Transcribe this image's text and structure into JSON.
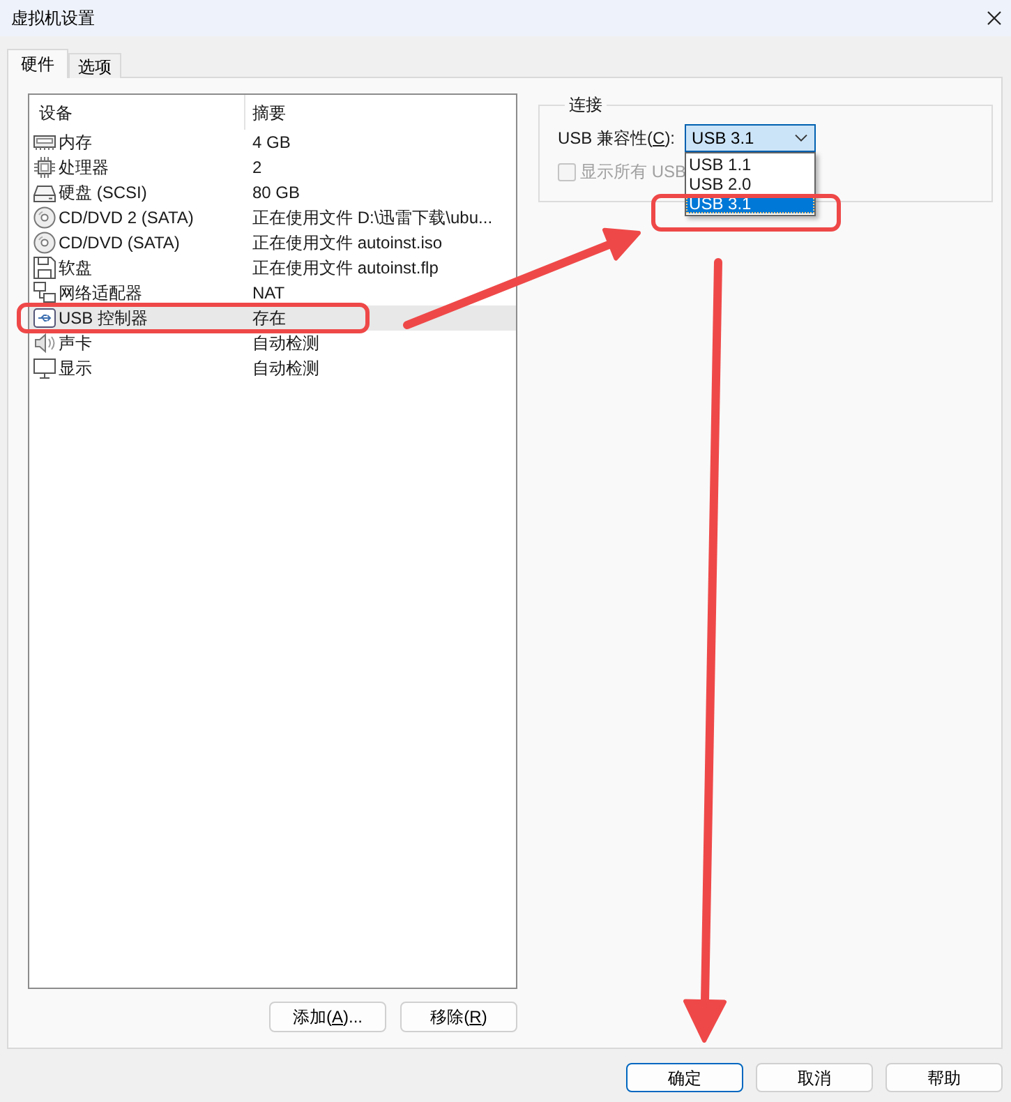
{
  "window": {
    "title": "虚拟机设置"
  },
  "tabs": [
    {
      "label": "硬件",
      "selected": true
    },
    {
      "label": "选项",
      "selected": false
    }
  ],
  "device_list": {
    "columns": [
      "设备",
      "摘要"
    ],
    "rows": [
      {
        "kind": "memory",
        "device": "内存",
        "summary": "4 GB",
        "selected": false,
        "annotated": false
      },
      {
        "kind": "processor",
        "device": "处理器",
        "summary": "2",
        "selected": false,
        "annotated": false
      },
      {
        "kind": "disk",
        "device": "硬盘 (SCSI)",
        "summary": "80 GB",
        "selected": false,
        "annotated": false
      },
      {
        "kind": "cdrom",
        "device": "CD/DVD 2 (SATA)",
        "summary": "正在使用文件 D:\\迅雷下载\\ubu...",
        "selected": false,
        "annotated": false
      },
      {
        "kind": "cdrom",
        "device": "CD/DVD (SATA)",
        "summary": "正在使用文件 autoinst.iso",
        "selected": false,
        "annotated": false
      },
      {
        "kind": "floppy",
        "device": "软盘",
        "summary": "正在使用文件 autoinst.flp",
        "selected": false,
        "annotated": false
      },
      {
        "kind": "network",
        "device": "网络适配器",
        "summary": "NAT",
        "selected": false,
        "annotated": false
      },
      {
        "kind": "usb",
        "device": "USB 控制器",
        "summary": "存在",
        "selected": true,
        "annotated": true
      },
      {
        "kind": "sound",
        "device": "声卡",
        "summary": "自动检测",
        "selected": false,
        "annotated": false
      },
      {
        "kind": "display",
        "device": "显示",
        "summary": "自动检测",
        "selected": false,
        "annotated": false
      }
    ]
  },
  "list_buttons": [
    {
      "before": "添加(",
      "access_key": "A",
      "after": ")..."
    },
    {
      "before": "移除(",
      "access_key": "R",
      "after": ")"
    }
  ],
  "connection_group": {
    "title": "连接",
    "compatibility": {
      "label": {
        "before": "USB 兼容性(",
        "access_key": "C",
        "after": "):"
      },
      "value": "USB 3.1",
      "expanded": true,
      "options": [
        {
          "label": "USB 1.1",
          "selected": false,
          "annotated": false
        },
        {
          "label": "USB 2.0",
          "selected": false,
          "annotated": false
        },
        {
          "label": "USB 3.1",
          "selected": true,
          "annotated": true
        }
      ]
    },
    "show_all_checkbox": {
      "label": "显示所有 USB",
      "checked": false,
      "disabled": true
    }
  },
  "dialog_buttons": [
    {
      "label": "确定",
      "default": true
    },
    {
      "label": "取消",
      "default": false
    },
    {
      "label": "帮助",
      "default": false
    }
  ]
}
